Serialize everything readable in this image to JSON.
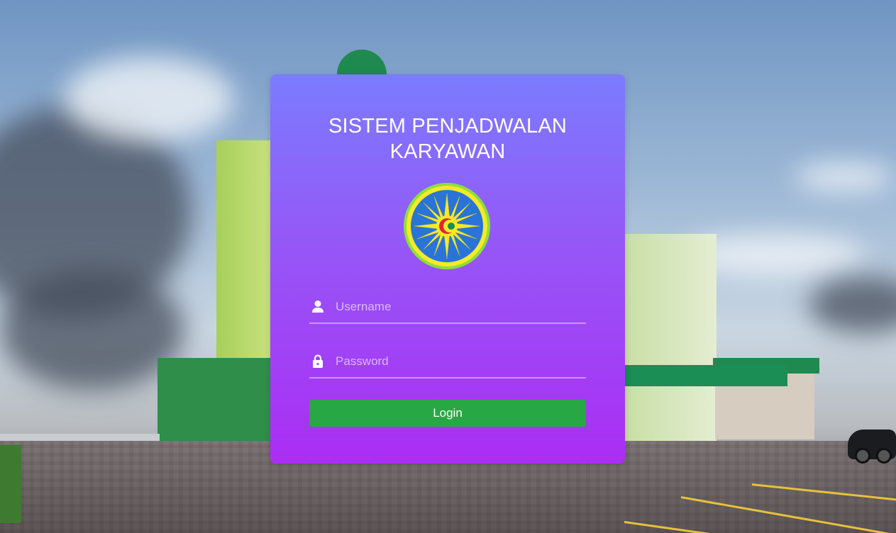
{
  "login": {
    "title_line1": "SISTEM PENJADWALAN",
    "title_line2": "KARYAWAN",
    "username": {
      "placeholder": "Username",
      "value": ""
    },
    "password": {
      "placeholder": "Password",
      "value": ""
    },
    "button_label": "Login"
  },
  "icons": {
    "username": "user-icon",
    "password": "lock-icon",
    "logo": "emblem-logo"
  },
  "colors": {
    "card_top": "#7b7cfe",
    "card_bottom": "#ab2df4",
    "button": "#28a745",
    "text": "#ffffff"
  }
}
